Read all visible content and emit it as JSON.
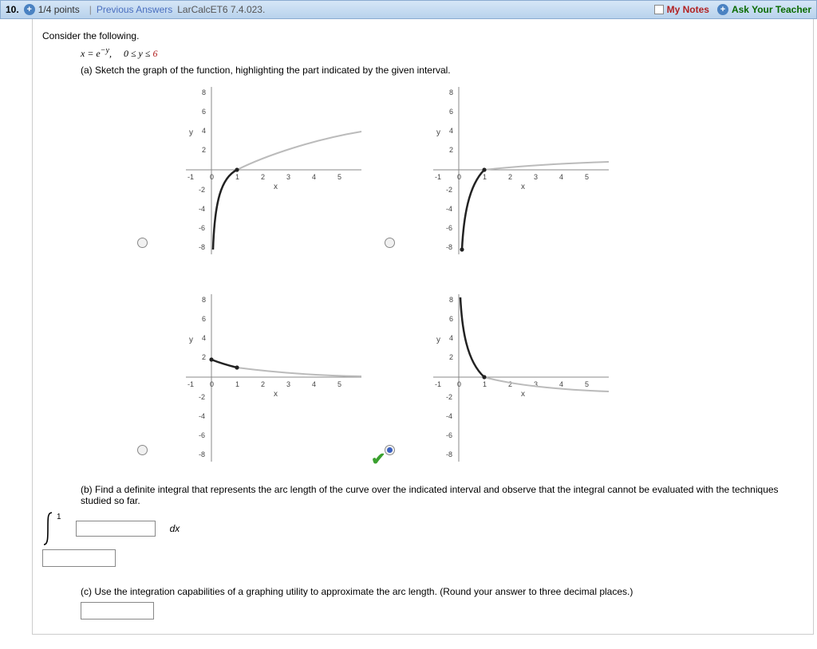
{
  "topbar": {
    "qnum": "10.",
    "points": "1/4 points",
    "prev_answers": "Previous Answers",
    "source": "LarCalcET6 7.4.023.",
    "my_notes": "My Notes",
    "ask": "Ask Your Teacher"
  },
  "intro": "Consider the following.",
  "equation_lhs": "x = e",
  "equation_exp": "−y",
  "equation_sep": ",",
  "equation_rhs_a": "0 ≤ y ≤ ",
  "equation_rhs_b": "6",
  "part_a": "(a) Sketch the graph of the function, highlighting the part indicated by the given interval.",
  "axis": {
    "xticks": [
      "-1",
      "0",
      "1",
      "2",
      "3",
      "4",
      "5"
    ],
    "yticks_top": [
      "8",
      "6",
      "4",
      "2"
    ],
    "yticks_bot": [
      "-2",
      "-4",
      "-6",
      "-8"
    ],
    "xlabel": "x",
    "ylabel": "y"
  },
  "part_b": "(b) Find a definite integral that represents the arc length of the curve over the indicated interval and observe that the integral cannot be evaluated with the techniques studied so far.",
  "integral": {
    "upper": "1",
    "lower_placeholder": "",
    "integrand_placeholder": "",
    "dx": "dx"
  },
  "part_c": "(c) Use the integration capabilities of a graphing utility to approximate the arc length. (Round your answer to three decimal places.)",
  "selected_option": 4
}
